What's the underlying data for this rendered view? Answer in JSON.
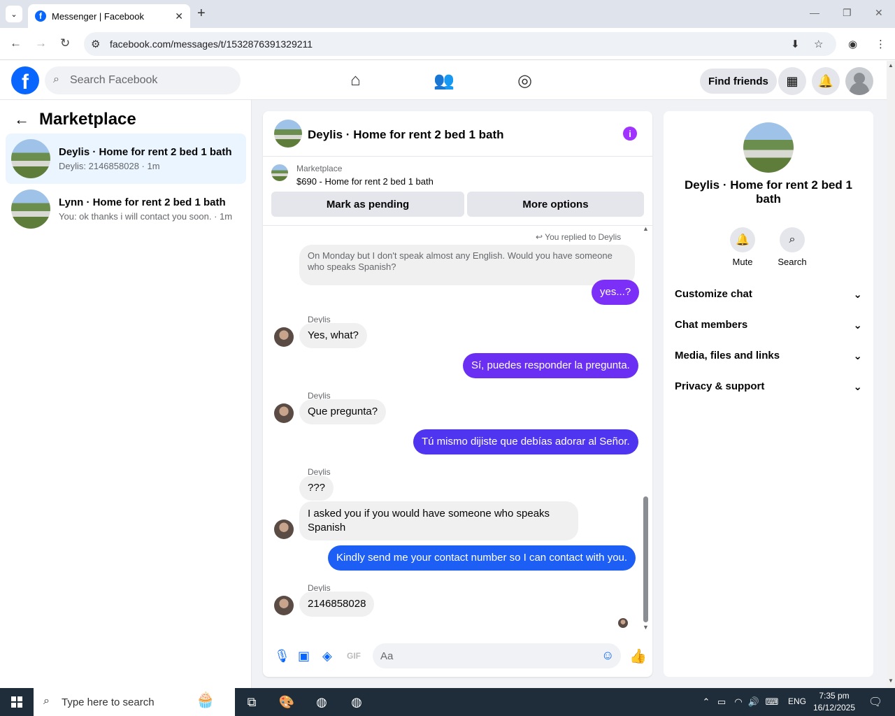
{
  "browser": {
    "tab_title": "Messenger | Facebook",
    "url": "facebook.com/messages/t/1532876391329211"
  },
  "header": {
    "search_placeholder": "Search Facebook",
    "find_friends": "Find friends"
  },
  "left": {
    "title": "Marketplace",
    "conversations": [
      {
        "name": "Deylis · Home for rent 2 bed 1 bath",
        "preview": "Deylis: 2146858028 · 1m"
      },
      {
        "name": "Lynn · Home for rent 2 bed 1 bath",
        "preview": "You: ok thanks i will contact you soon. · 1m"
      }
    ]
  },
  "chat": {
    "title": "Deylis · Home for rent 2 bed 1 bath",
    "listing_label": "Marketplace",
    "listing_price": "$690 - Home for rent 2 bed 1 bath",
    "btn_pending": "Mark as pending",
    "btn_more": "More options",
    "replied_to": "You replied to Deylis",
    "quoted": "On Monday but I don't speak almost any English. Would you have someone who speaks Spanish?",
    "messages": [
      {
        "text": "yes...?"
      },
      {
        "sender": "Deylis",
        "text": "Yes, what?"
      },
      {
        "text": "Sí, puedes responder la pregunta."
      },
      {
        "sender": "Deylis",
        "text": "Que pregunta?"
      },
      {
        "text": "Tú mismo dijiste que debías adorar al Señor."
      },
      {
        "sender": "Deylis",
        "text": "???"
      },
      {
        "text": "I asked you if you would have someone who speaks Spanish"
      },
      {
        "text": "Kindly send me your contact number so I can contact with you."
      },
      {
        "sender": "Deylis",
        "text": "2146858028"
      }
    ],
    "composer_placeholder": "Aa"
  },
  "right": {
    "title": "Deylis · Home for rent 2 bed 1 bath",
    "mute": "Mute",
    "search": "Search",
    "sections": [
      "Customize chat",
      "Chat members",
      "Media, files and links",
      "Privacy & support"
    ]
  },
  "taskbar": {
    "search_placeholder": "Type here to search",
    "lang": "ENG",
    "time": "7:35 pm",
    "date": "16/12/2025"
  },
  "colors": {
    "fb_blue": "#0866ff",
    "bubble_purple": "#7b2ff7",
    "bubble_blue": "#1d5ef5"
  }
}
